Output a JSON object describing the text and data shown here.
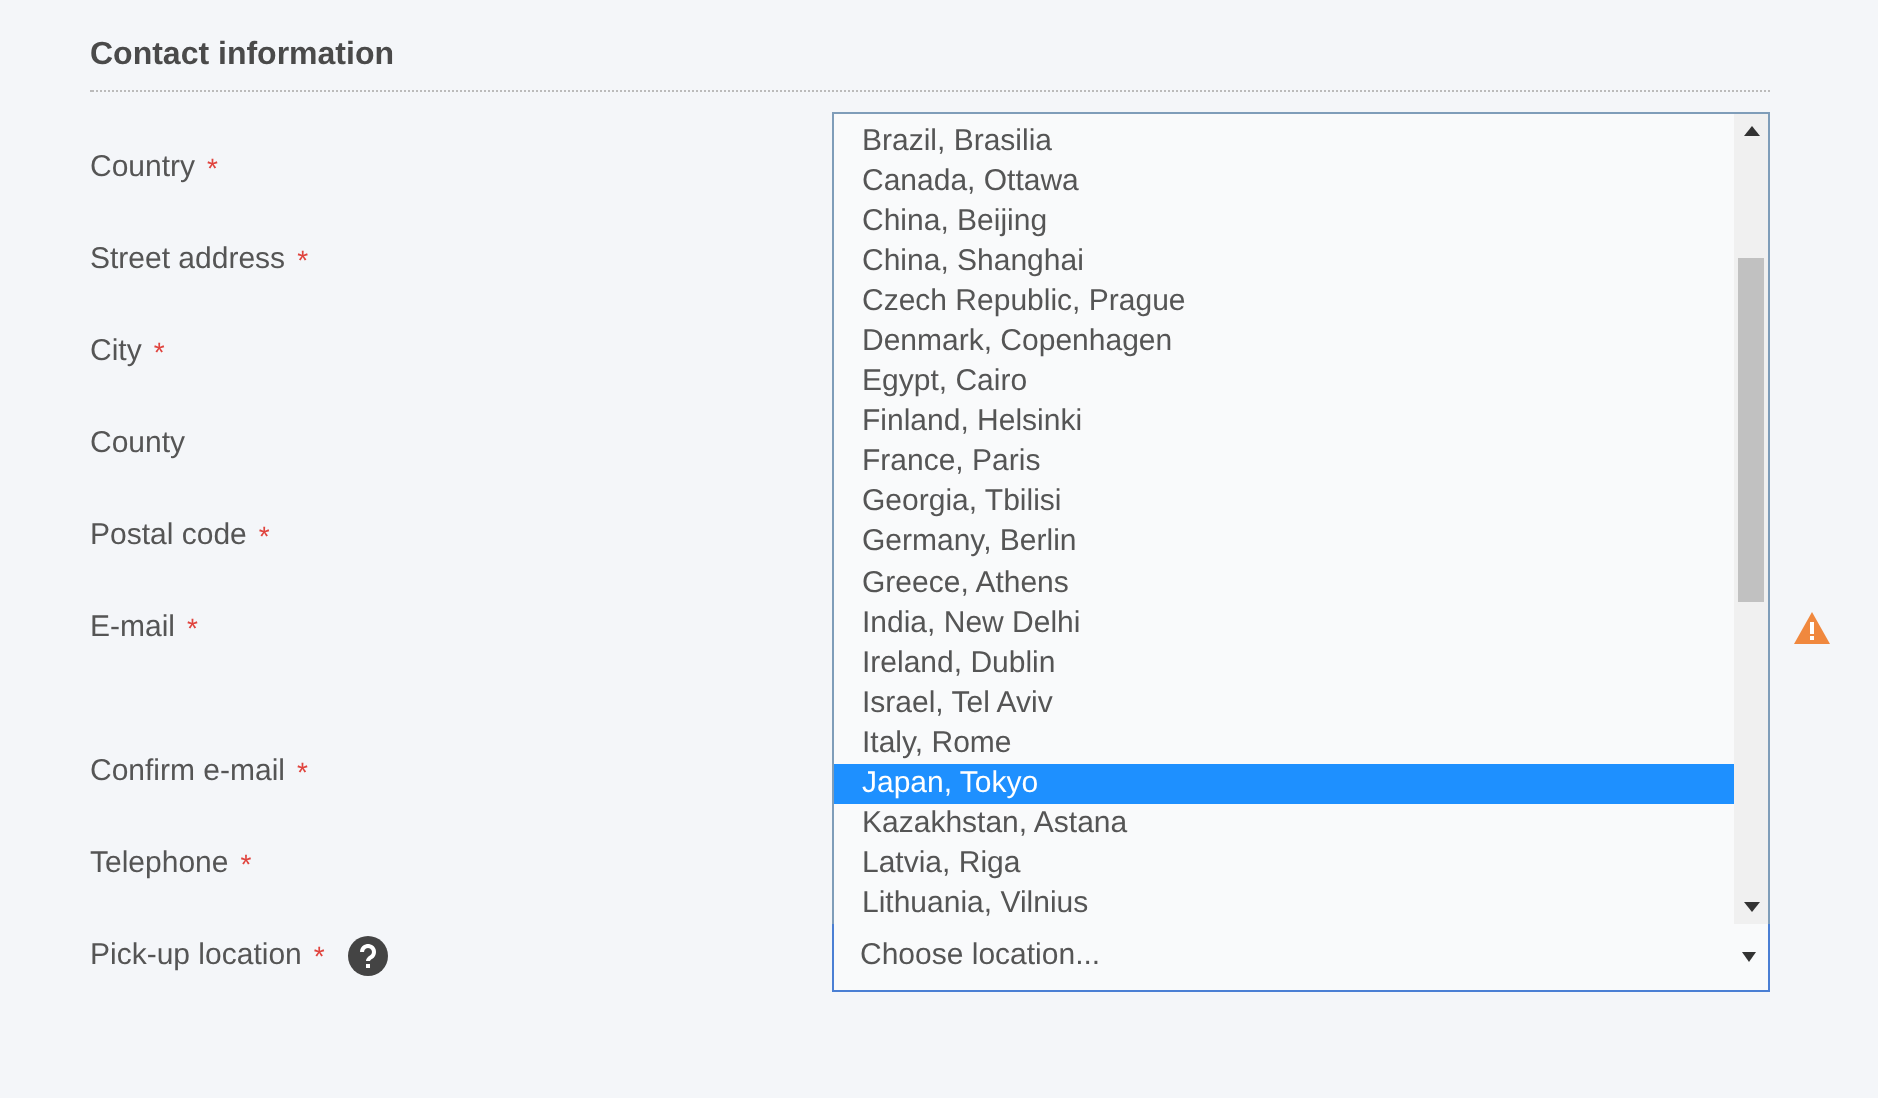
{
  "section": {
    "title": "Contact information"
  },
  "fields": [
    {
      "label": "Country",
      "required_mark": "*"
    },
    {
      "label": "Street address",
      "required_mark": "*"
    },
    {
      "label": "City",
      "required_mark": "*"
    },
    {
      "label": "County"
    },
    {
      "label": "Postal code",
      "required_mark": "*"
    },
    {
      "label": "E-mail",
      "required_mark": "*",
      "warning": true
    },
    {
      "label": "Confirm e-mail",
      "required_mark": "*"
    },
    {
      "label": "Telephone",
      "required_mark": "*"
    },
    {
      "label": "Pick-up location",
      "required_mark": "*",
      "help": true
    }
  ],
  "pickup_select": {
    "placeholder": "Choose location...",
    "expanded": true,
    "options": [
      {
        "label": "Brazil, Brasilia",
        "selected": false
      },
      {
        "label": "Canada, Ottawa",
        "selected": false
      },
      {
        "label": "China, Beijing",
        "selected": false
      },
      {
        "label": "China, Shanghai",
        "selected": false
      },
      {
        "label": "Czech Republic, Prague",
        "selected": false
      },
      {
        "label": "Denmark, Copenhagen",
        "selected": false
      },
      {
        "label": "Egypt, Cairo",
        "selected": false
      },
      {
        "label": "Finland, Helsinki",
        "selected": false
      },
      {
        "label": "France, Paris",
        "selected": false
      },
      {
        "label": "Georgia, Tbilisi",
        "selected": false
      },
      {
        "label": "Germany, Berlin",
        "selected": false
      },
      {
        "label": "Greece, Athens",
        "selected": false
      },
      {
        "label": "India, New Delhi",
        "selected": false
      },
      {
        "label": "Ireland, Dublin",
        "selected": false
      },
      {
        "label": "Israel, Tel Aviv",
        "selected": false
      },
      {
        "label": "Italy, Rome",
        "selected": false
      },
      {
        "label": "Japan, Tokyo",
        "selected": true
      },
      {
        "label": "Kazakhstan, Astana",
        "selected": false
      },
      {
        "label": "Latvia, Riga",
        "selected": false
      },
      {
        "label": "Lithuania, Vilnius",
        "selected": false
      }
    ]
  }
}
